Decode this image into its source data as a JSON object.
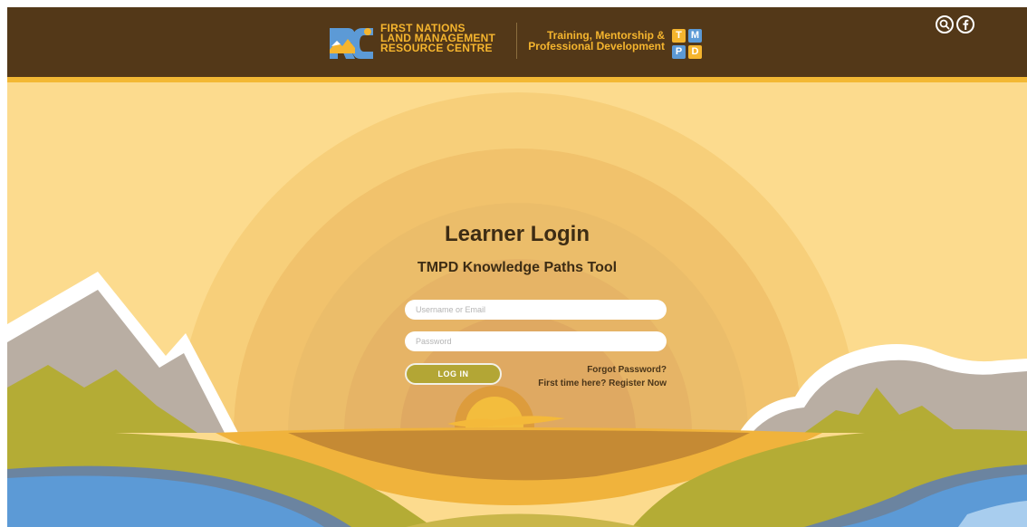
{
  "header": {
    "org_line1": "FIRST NATIONS",
    "org_line2": "LAND MANAGEMENT",
    "org_line3": "RESOURCE CENTRE",
    "logo_letters": "RC",
    "tagline_line1": "Training, Mentorship &",
    "tagline_line2": "Professional Development",
    "badge_letters": [
      "T",
      "M",
      "P",
      "D"
    ],
    "icons": [
      "search-icon",
      "facebook-icon"
    ]
  },
  "login": {
    "title": "Learner Login",
    "subtitle": "TMPD Knowledge Paths Tool",
    "username_placeholder": "Username or Email",
    "password_placeholder": "Password",
    "login_label": "LOG IN",
    "forgot_label": "Forgot Password?",
    "register_label": "First time here? Register Now"
  },
  "colors": {
    "header_bg": "#533818",
    "accent_gold": "#f5b52e",
    "sky": "#fcdb8e",
    "button": "#b3a635",
    "hills": "#b4ac35",
    "water": "#5c9ad6"
  }
}
